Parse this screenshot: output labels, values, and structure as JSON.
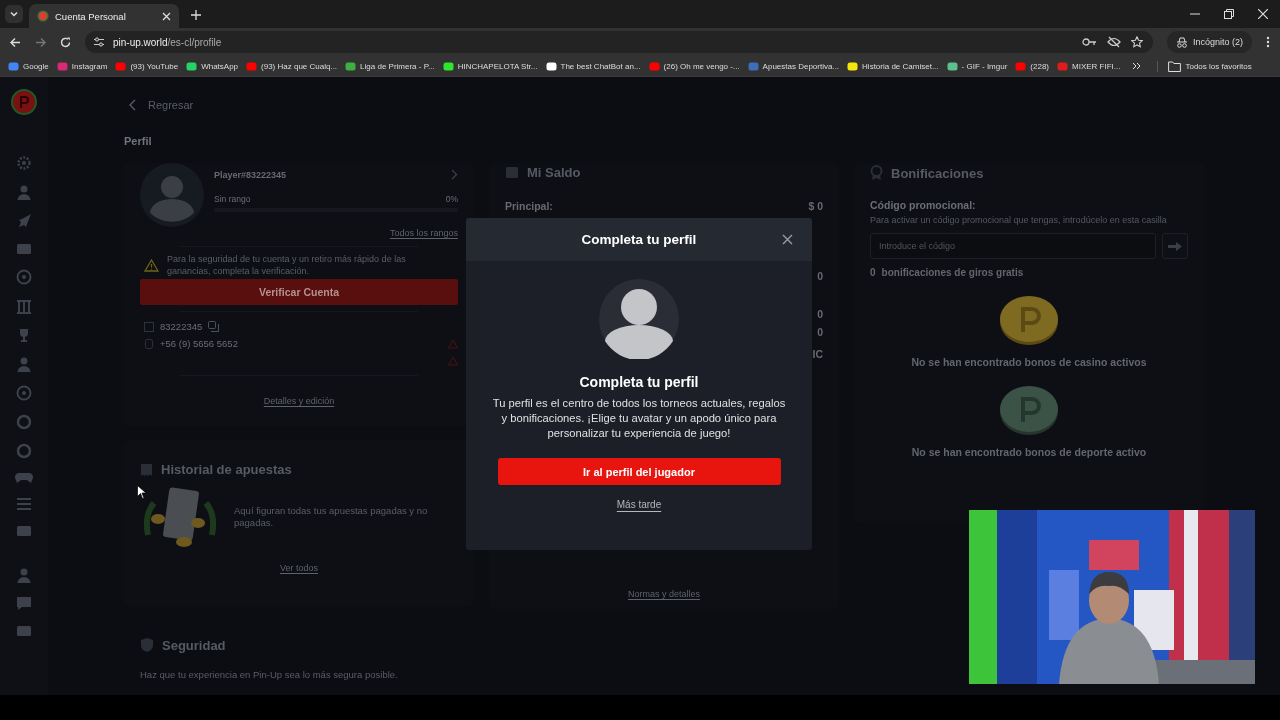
{
  "browser": {
    "tabs": [
      {
        "title": "Cuenta Personal",
        "selected": true
      }
    ],
    "url_host": "pin-up.world",
    "url_path": "/es-cl/profile",
    "profile": "Incógnito (2)",
    "bookmarks": [
      {
        "label": "Google"
      },
      {
        "label": "Instagram"
      },
      {
        "label": "(93) YouTube"
      },
      {
        "label": "WhatsApp"
      },
      {
        "label": "(93) Haz que Cualq..."
      },
      {
        "label": "Liga de Primera - P..."
      },
      {
        "label": "HINCHAPELOTA Str..."
      },
      {
        "label": "The best ChatBot an..."
      },
      {
        "label": "(26) Oh me vengo -..."
      },
      {
        "label": "Apuestas Deportiva..."
      },
      {
        "label": "Historia de Camiset..."
      },
      {
        "label": "- GIF - Imgur"
      },
      {
        "label": "(228)"
      },
      {
        "label": "MIXER FIFI..."
      }
    ],
    "all_bookmarks": "Todos los favoritos"
  },
  "page": {
    "back": "Regresar",
    "heading": "Perfil",
    "profile": {
      "name": "Player#83222345",
      "rank": "Sin rango",
      "rank_percent": "0%",
      "level": 0,
      "all_ranks": "Todos los rangos",
      "warning": "Para la seguridad de tu cuenta y un retiro más rápido de las ganancias, completa la verificación.",
      "verify_button": "Verificar Cuenta",
      "account_id": "83222345",
      "phone": "+56 (9) 5656 5652",
      "details_link": "Detalles y edición"
    },
    "bets": {
      "title": "Historial de apuestas",
      "text": "Aquí figuran todas tus apuestas pagadas y no pagadas.",
      "link": "Ver todos"
    },
    "balance": {
      "title": "Mi Saldo",
      "principal_label": "Principal:",
      "principal_value": "$ 0",
      "values": [
        "0",
        "0",
        "0",
        "IC"
      ],
      "link": "Normas y detalles"
    },
    "bonuses": {
      "title": "Bonificaciones",
      "promo_label": "Código promocional:",
      "promo_hint": "Para activar un código promocional que tengas, introdúcelo en esta casilla",
      "promo_placeholder": "Introduce el código",
      "free_spins_count": "0",
      "free_spins_label": "bonificaciones de giros gratis",
      "casino_empty": "No se han encontrado bonos de casino activos",
      "sport_empty": "No se han encontrado bonos de deporte activo"
    },
    "security": {
      "title": "Seguridad",
      "text": "Haz que tu experiencia en Pin-Up sea lo más segura posible."
    }
  },
  "modal": {
    "title": "Completa tu perfil",
    "heading": "Completa tu perfil",
    "text": "Tu perfil es el centro de todos los torneos actuales, regalos y bonificaciones. ¡Elige tu avatar y un apodo único para personalizar tu experiencia de juego!",
    "primary_button": "Ir al perfil del jugador",
    "secondary_link": "Más tarde"
  }
}
